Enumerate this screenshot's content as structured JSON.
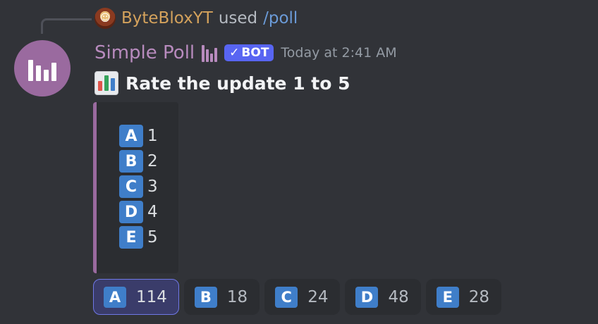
{
  "reply": {
    "user": "ByteBloxYT",
    "used": "used",
    "command": "/poll"
  },
  "message": {
    "bot_name": "Simple Poll",
    "bot_tag": "BOT",
    "bot_tag_check": "✓",
    "timestamp": "Today at 2:41 AM",
    "title": "Rate the update 1 to 5"
  },
  "options": [
    {
      "letter": "A",
      "text": "1"
    },
    {
      "letter": "B",
      "text": "2"
    },
    {
      "letter": "C",
      "text": "3"
    },
    {
      "letter": "D",
      "text": "4"
    },
    {
      "letter": "E",
      "text": "5"
    }
  ],
  "buttons": [
    {
      "letter": "A",
      "count": "114",
      "selected": true
    },
    {
      "letter": "B",
      "count": "18",
      "selected": false
    },
    {
      "letter": "C",
      "count": "24",
      "selected": false
    },
    {
      "letter": "D",
      "count": "48",
      "selected": false
    },
    {
      "letter": "E",
      "count": "28",
      "selected": false
    }
  ],
  "colors": {
    "background": "#313338",
    "embed_accent": "#9a6a9f",
    "letter_badge": "#3f7ec9",
    "bot_tag": "#5865f2"
  },
  "icons": {
    "reply_avatar": "user-avatar-icon",
    "bot_avatar": "bar-chart-icon",
    "title_emoji": "bar-chart-emoji-icon"
  }
}
